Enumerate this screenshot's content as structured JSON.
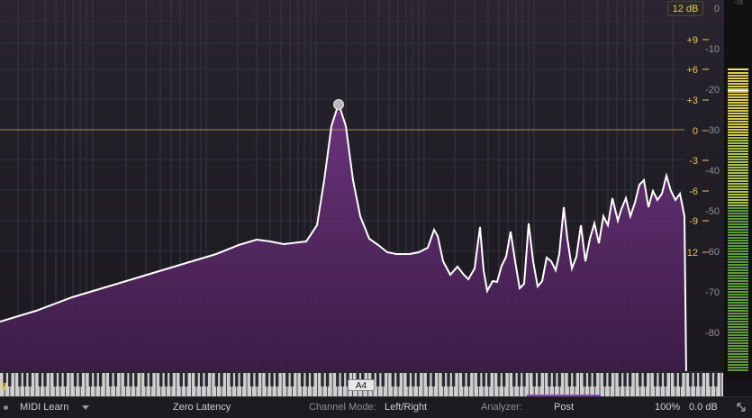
{
  "display": {
    "range_label": "12 dB",
    "gain_scale": [
      "+9",
      "+6",
      "+3",
      "0",
      "-3",
      "-6",
      "-9",
      "-12"
    ],
    "analyzer_scale": [
      "0",
      "-10",
      "-20",
      "-30",
      "-40",
      "-50",
      "-60",
      "-70",
      "-80"
    ],
    "meter_top_label": "-15",
    "piano_note": "A4"
  },
  "statusbar": {
    "midi_learn": "MIDI Learn",
    "latency": "Zero Latency",
    "channel_mode_label": "Channel Mode:",
    "channel_mode_value": "Left/Right",
    "analyzer_label": "Analyzer:",
    "analyzer_value": "Post",
    "zoom": "100%",
    "output_gain": "0.0 dB"
  },
  "colors": {
    "gain_scale": "#e9c45c",
    "analyzer_scale": "#8f8f95",
    "curve": "#ffffff",
    "spectrum_fill": "#5b2a6a",
    "zero_line": "#b39a6a",
    "meter": "#c8c24a"
  },
  "icons": {
    "dropdown": "chevron-down-icon",
    "resize": "resize-icon",
    "band_node": "band-node-icon"
  }
}
